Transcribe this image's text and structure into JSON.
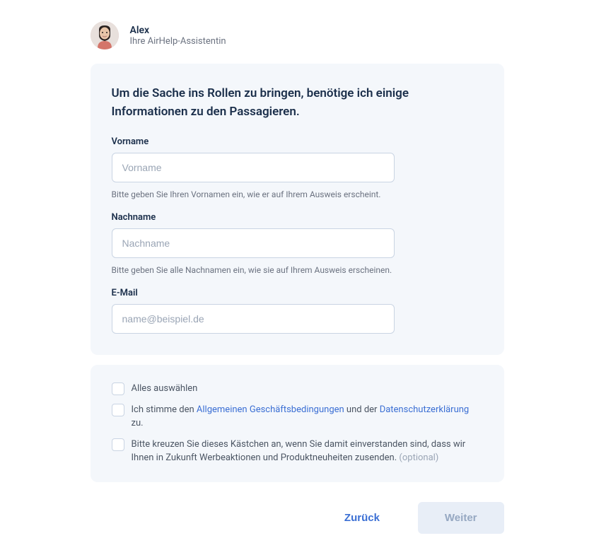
{
  "header": {
    "name": "Alex",
    "role": "Ihre AirHelp-Assistentin"
  },
  "form": {
    "title": "Um die Sache ins Rollen zu bringen, benötige ich einige Informationen zu den Passagieren.",
    "fields": {
      "firstName": {
        "label": "Vorname",
        "placeholder": "Vorname",
        "hint": "Bitte geben Sie Ihren Vornamen ein, wie er auf Ihrem Ausweis erscheint."
      },
      "lastName": {
        "label": "Nachname",
        "placeholder": "Nachname",
        "hint": "Bitte geben Sie alle Nachnamen ein, wie sie auf Ihrem Ausweis erscheinen."
      },
      "email": {
        "label": "E-Mail",
        "placeholder": "name@beispiel.de"
      }
    }
  },
  "consent": {
    "selectAll": "Alles auswählen",
    "terms": {
      "prefix": "Ich stimme den ",
      "link1": "Allgemeinen Geschäftsbedingungen",
      "middle": " und der ",
      "link2": "Datenschutzerklärung",
      "suffix": " zu."
    },
    "marketing": {
      "text": "Bitte kreuzen Sie dieses Kästchen an, wenn Sie damit einverstanden sind, dass wir Ihnen in Zukunft Werbeaktionen und Produktneuheiten zusenden. ",
      "optional": "(optional)"
    }
  },
  "buttons": {
    "back": "Zurück",
    "next": "Weiter"
  }
}
